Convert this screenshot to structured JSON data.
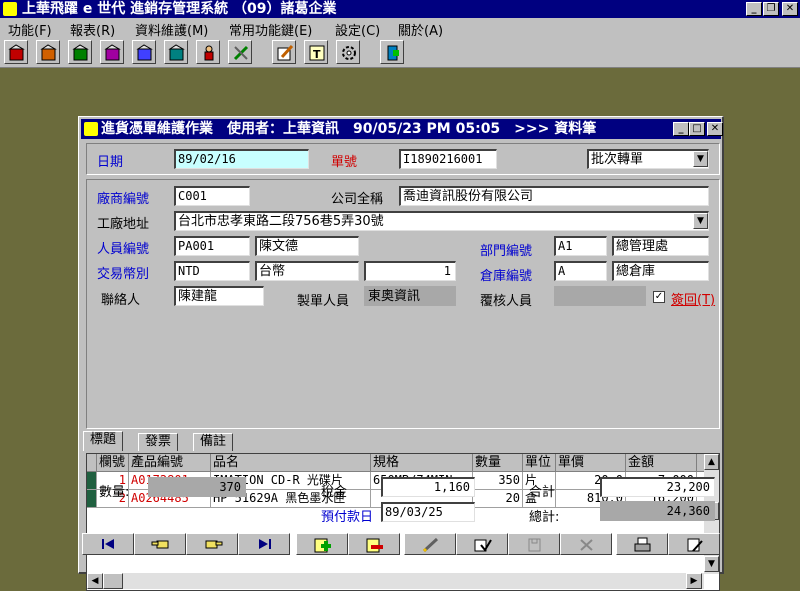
{
  "app": {
    "title": "上華飛躍 e 世代 進銷存管理系統 （09）諸葛企業"
  },
  "menu": [
    "功能(F)",
    "報表(R)",
    "資料維護(M)",
    "常用功能鍵(E)",
    "設定(C)",
    "關於(A)"
  ],
  "window": {
    "title": "進貨憑單維護作業　使用者：上華資訊　90/05/23 PM 05:05　>>> 資料筆"
  },
  "header": {
    "date_label": "日期",
    "date_value": "89/02/16",
    "order_label": "單號",
    "order_value": "I1890216001",
    "batch_value": "批次轉單"
  },
  "form": {
    "vendor_code_label": "廠商編號",
    "vendor_code": "C001",
    "company_label": "公司全稱",
    "company": "喬迪資訊股份有限公司",
    "factory_addr_label": "工廠地址",
    "factory_addr": "台北市忠孝東路二段756巷5弄30號",
    "staff_code_label": "人員編號",
    "staff_code": "PA001",
    "staff_name": "陳文德",
    "dept_code_label": "部門編號",
    "dept_code": "A1",
    "dept_name": "總管理處",
    "currency_label": "交易幣別",
    "currency_code": "NTD",
    "currency_name": "台幣",
    "exchange_rate": "1",
    "warehouse_label": "倉庫編號",
    "warehouse_code": "A",
    "warehouse_name": "總倉庫",
    "contact_label": "聯絡人",
    "contact": "陳建龍",
    "maker_label": "製單人員",
    "maker": "東奧資訊",
    "reviewer_label": "覆核人員",
    "reviewer": "",
    "return_label": "簽回(T)"
  },
  "tabs": [
    "標題",
    "發票",
    "備註"
  ],
  "grid": {
    "columns": [
      "欄號",
      "產品編號",
      "品名",
      "規格",
      "數量",
      "單位",
      "單價",
      "金額"
    ],
    "rows": [
      {
        "no": "1",
        "code": "A0172801",
        "name": "IMATION CD-R 光碟片",
        "spec": "650MB/74MIN",
        "qty": "350",
        "unit": "片",
        "price": "20.0",
        "amount": "7,000"
      },
      {
        "no": "2",
        "code": "A0264485",
        "name": "HP 51629A 黑色墨水匣",
        "spec": "",
        "qty": "20",
        "unit": "盒",
        "price": "810.0",
        "amount": "16,200"
      }
    ]
  },
  "footer": {
    "qty_label": "數量:",
    "qty_value": "370",
    "tax_label": "稅金",
    "tax_value": "1,160",
    "subtotal_label": "合計",
    "subtotal_value": "23,200",
    "prepay_label": "預付款日",
    "prepay_value": "89/03/25",
    "total_label": "總計:",
    "total_value": "24,360"
  },
  "colors": {
    "title_bar": "#000080",
    "desktop": "#6b6b3c",
    "label_blue": "#0000d0",
    "label_red": "#d00000",
    "highlight_field": "#c8ffff"
  }
}
